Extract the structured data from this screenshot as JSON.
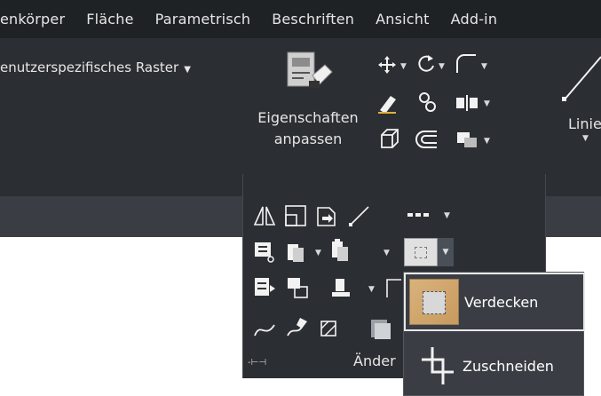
{
  "tabs": [
    "enkörper",
    "Fläche",
    "Parametrisch",
    "Beschriften",
    "Ansicht",
    "Add-in"
  ],
  "ribbon": {
    "raster_label": "enutzerspezifisches Raster",
    "big_button_label_line1": "Eigenschaften",
    "big_button_label_line2": "anpassen",
    "linie_label": "Linie"
  },
  "panel": {
    "label": "Änder"
  },
  "flyout": {
    "item1": "Verdecken",
    "item2": "Zuschneiden"
  },
  "icons": {
    "move": "move-icon",
    "rotate": "rotate-icon",
    "fillet": "fillet-icon",
    "mirror": "mirror-icon",
    "copy": "copy-icon",
    "array": "array-icon"
  },
  "colors": {
    "tabbar": "#1f2225",
    "ribbon": "#2b2e32",
    "strip": "#3a3e44",
    "text": "#e6e6e6"
  }
}
